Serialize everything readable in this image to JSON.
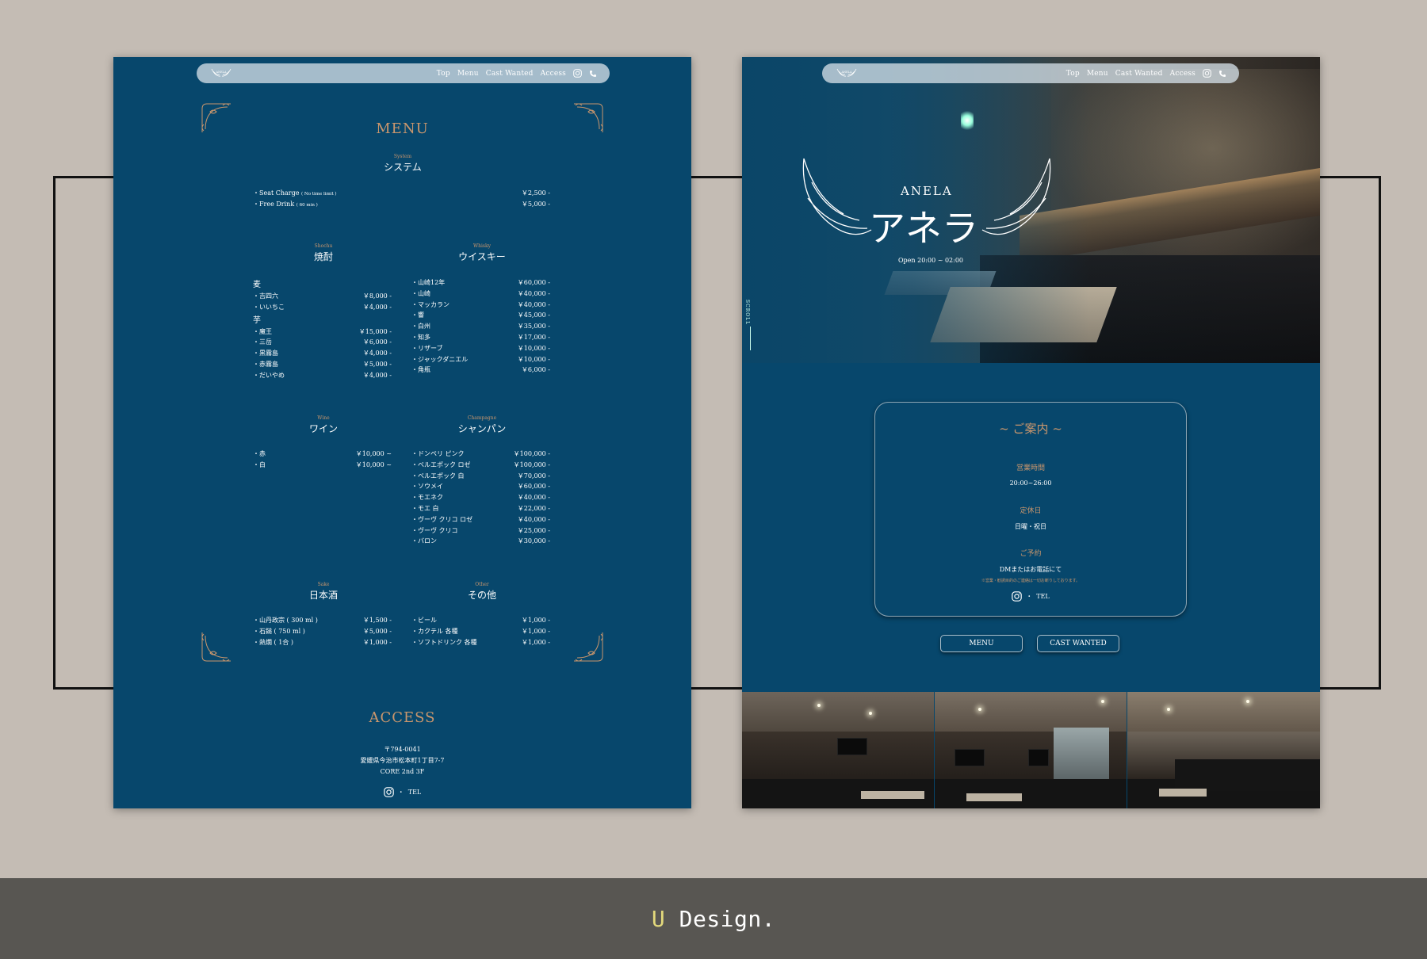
{
  "nav": {
    "links": [
      "Top",
      "Menu",
      "Cast Wanted",
      "Access"
    ],
    "logo_text": "ANELA"
  },
  "menu": {
    "title": "MENU",
    "system": {
      "en": "System",
      "jp": "システム",
      "items": [
        {
          "name": "・Seat Charge",
          "note": "( No time limit )",
          "price": "￥2,500 -"
        },
        {
          "name": "・Free Drink",
          "note": "( 60 min )",
          "price": "￥5,000 -"
        }
      ]
    },
    "shochu": {
      "en": "Shochu",
      "jp": "焼酎",
      "group1": "麦",
      "items1": [
        {
          "name": "・吉四六",
          "price": "￥8,000 -"
        },
        {
          "name": "・いいちこ",
          "price": "￥4,000 -"
        }
      ],
      "group2": "芋",
      "items2": [
        {
          "name": "・魔王",
          "price": "￥15,000 -"
        },
        {
          "name": "・三岳",
          "price": "￥6,000 -"
        },
        {
          "name": "・黒霧島",
          "price": "￥4,000 -"
        },
        {
          "name": "・赤霧島",
          "price": "￥5,000 -"
        },
        {
          "name": "・だいやめ",
          "price": "￥4,000 -"
        }
      ]
    },
    "whisky": {
      "en": "Whisky",
      "jp": "ウイスキー",
      "items": [
        {
          "name": "・山崎12年",
          "price": "￥60,000 -"
        },
        {
          "name": "・山崎",
          "price": "￥40,000 -"
        },
        {
          "name": "・マッカラン",
          "price": "￥40,000 -"
        },
        {
          "name": "・響",
          "price": "￥45,000 -"
        },
        {
          "name": "・白州",
          "price": "￥35,000 -"
        },
        {
          "name": "・知多",
          "price": "￥17,000 -"
        },
        {
          "name": "・リザーブ",
          "price": "￥10,000 -"
        },
        {
          "name": "・ジャックダニエル",
          "price": "￥10,000 -"
        },
        {
          "name": "・角瓶",
          "price": "￥6,000 -"
        }
      ]
    },
    "wine": {
      "en": "Wine",
      "jp": "ワイン",
      "items": [
        {
          "name": "・赤",
          "price": "￥10,000 ~"
        },
        {
          "name": "・白",
          "price": "￥10,000 ~"
        }
      ]
    },
    "champagne": {
      "en": "Champagne",
      "jp": "シャンパン",
      "items": [
        {
          "name": "・ドンペリ ピンク",
          "price": "￥100,000 -"
        },
        {
          "name": "・ベルエポック ロゼ",
          "price": "￥100,000 -"
        },
        {
          "name": "・ベルエポック 白",
          "price": "￥70,000 -"
        },
        {
          "name": "・ソウメイ",
          "price": "￥60,000 -"
        },
        {
          "name": "・モエネク",
          "price": "￥40,000 -"
        },
        {
          "name": "・モエ 白",
          "price": "￥22,000 -"
        },
        {
          "name": "・ヴーヴ クリコ ロゼ",
          "price": "￥40,000 -"
        },
        {
          "name": "・ヴーヴ クリコ",
          "price": "￥25,000 -"
        },
        {
          "name": "・バロン",
          "price": "￥30,000 -"
        }
      ]
    },
    "sake": {
      "en": "Sake",
      "jp": "日本酒",
      "items": [
        {
          "name": "・山丹政宗 ( 300 ml )",
          "price": "￥1,500 -"
        },
        {
          "name": "・石鎚 ( 750 ml )",
          "price": "￥5,000 -"
        },
        {
          "name": "・熱燗 ( 1合 )",
          "price": "￥1,000 -"
        }
      ]
    },
    "other": {
      "en": "Other",
      "jp": "その他",
      "items": [
        {
          "name": "・ビール",
          "price": "￥1,000 -"
        },
        {
          "name": "・カクテル 各種",
          "price": "￥1,000 -"
        },
        {
          "name": "・ソフトドリンク 各種",
          "price": "￥1,000 -"
        }
      ]
    }
  },
  "access": {
    "title": "ACCESS",
    "postal": "〒794-0041",
    "address": "愛媛県今治市松本町1丁目7-7",
    "building": "CORE 2nd 3F",
    "tel": "TEL"
  },
  "hero": {
    "brand": "ANELA",
    "kana": "アネラ",
    "hours": "Open 20:00 ~ 02:00",
    "scroll": "SCROLL"
  },
  "guide": {
    "title": "~ ご案内 ~",
    "hours_label": "営業時間",
    "hours": "20:00~26:00",
    "closed_label": "定休日",
    "closed": "日曜・祝日",
    "reserve_label": "ご予約",
    "reserve": "DMまたはお電話にて",
    "note": "※営業・勧誘目的のご連絡は一切お断りしております。",
    "tel": "TEL"
  },
  "buttons": {
    "menu": "MENU",
    "cast": "CAST WANTED"
  },
  "footer": {
    "u": "U",
    "rest": " Design."
  },
  "colors": {
    "page": "#07476c",
    "gold": "#c9966d",
    "background": "#c4bcb4",
    "footer": "#585652"
  }
}
